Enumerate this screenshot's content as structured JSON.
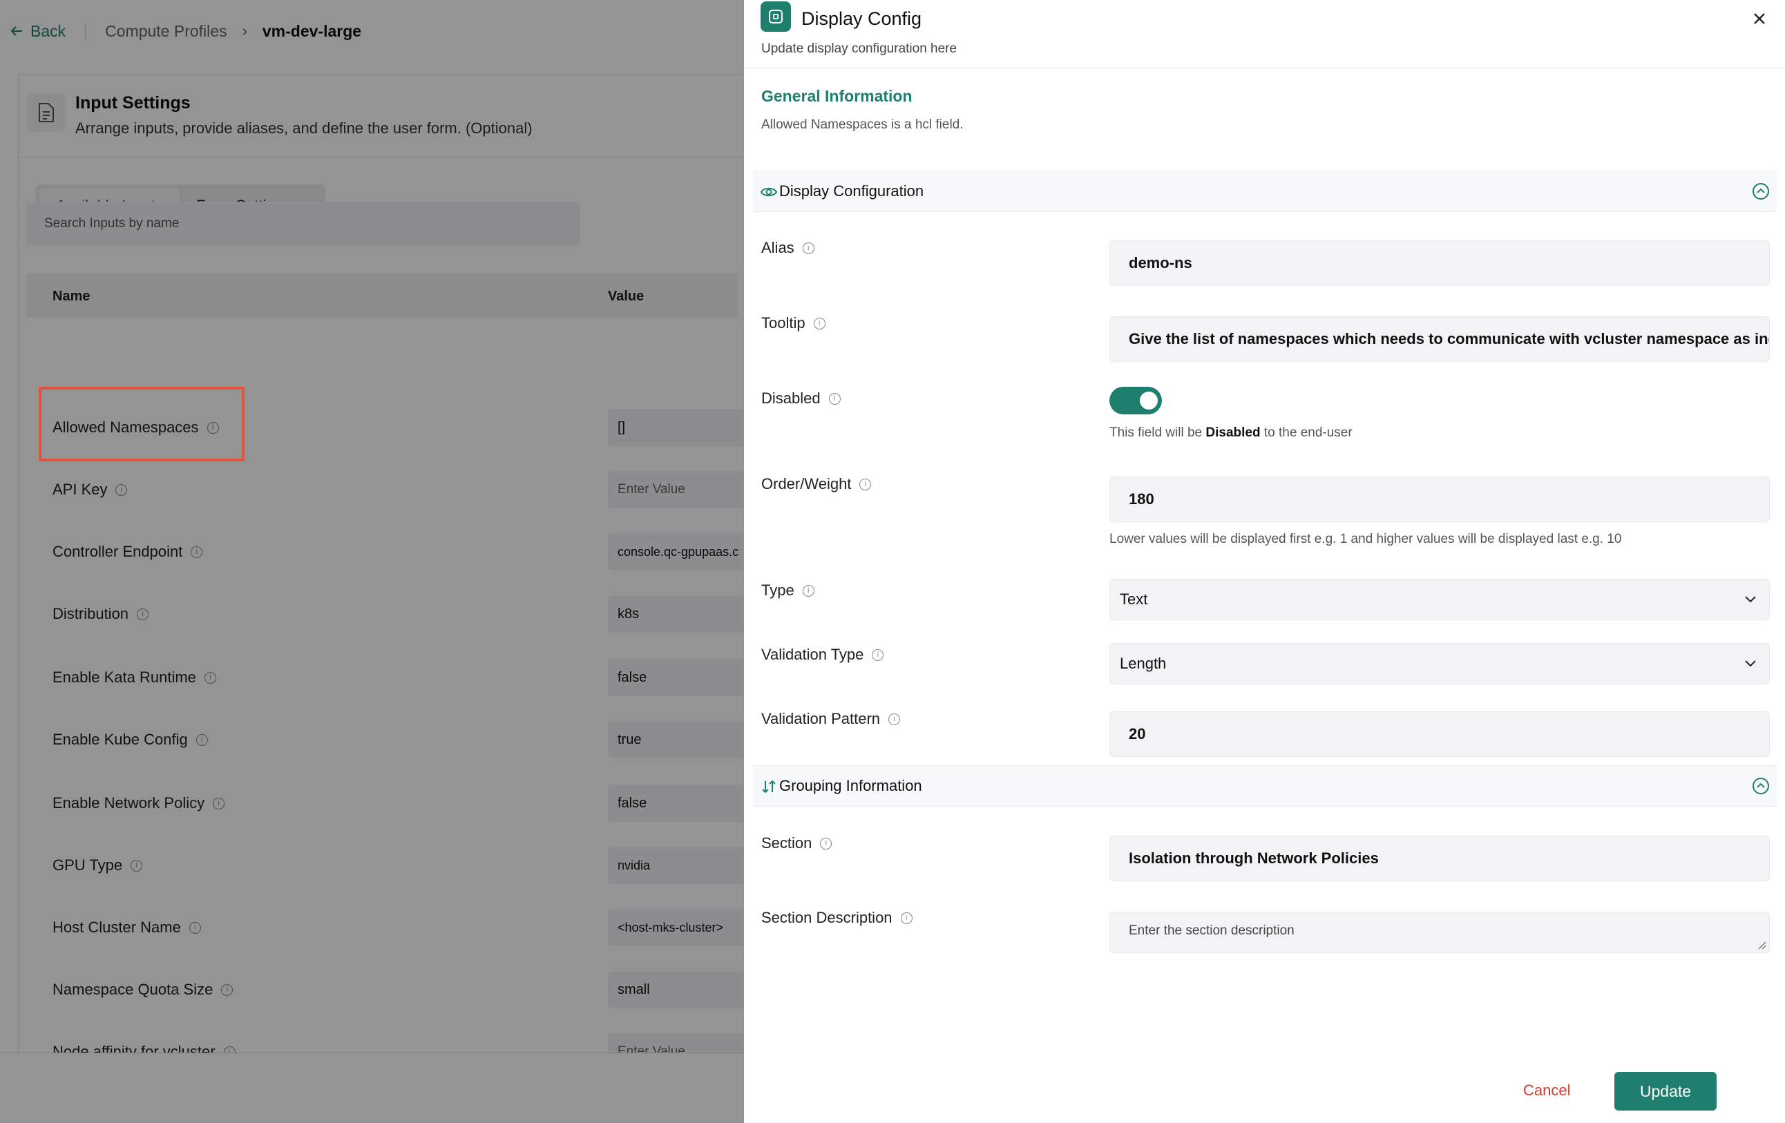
{
  "breadcrumb": {
    "back_label": "Back",
    "parent": "Compute Profiles",
    "current": "vm-dev-large"
  },
  "input_settings": {
    "title": "Input Settings",
    "subtitle": "Arrange inputs, provide aliases, and define the user form. (Optional)",
    "tabs": [
      {
        "label": "Available Inputs",
        "active": true
      },
      {
        "label": "Form Settings",
        "active": false
      }
    ],
    "search_placeholder": "Search Inputs by name",
    "columns": {
      "name": "Name",
      "value": "Value"
    },
    "rows": [
      {
        "name": "Allowed Namespaces",
        "value": "[]",
        "placeholder": false
      },
      {
        "name": "API Key",
        "value": "Enter Value",
        "placeholder": true
      },
      {
        "name": "Controller Endpoint",
        "value": "console.qc-gpupaas.c",
        "placeholder": false
      },
      {
        "name": "Distribution",
        "value": "k8s",
        "placeholder": false
      },
      {
        "name": "Enable Kata Runtime",
        "value": "false",
        "placeholder": false
      },
      {
        "name": "Enable Kube Config",
        "value": "true",
        "placeholder": false
      },
      {
        "name": "Enable Network Policy",
        "value": "false",
        "placeholder": false
      },
      {
        "name": "GPU Type",
        "value": "nvidia",
        "placeholder": false
      },
      {
        "name": "Host Cluster Name",
        "value": "<host-mks-cluster>",
        "placeholder": false
      },
      {
        "name": "Namespace Quota Size",
        "value": "small",
        "placeholder": false
      },
      {
        "name": "Node affinity for vcluster",
        "value": "Enter Value",
        "placeholder": true
      }
    ],
    "highlighted_row": "Allowed Namespaces"
  },
  "panel": {
    "title": "Display Config",
    "subtitle": "Update display configuration here",
    "general": {
      "title": "General Information",
      "field_name": "Allowed Namespaces",
      "field_note": " is a hcl field."
    },
    "display_section": {
      "title": "Display Configuration",
      "expanded": true
    },
    "fields": {
      "alias": {
        "label": "Alias",
        "value": "demo-ns"
      },
      "tooltip": {
        "label": "Tooltip",
        "value": "Give the list of namespaces which needs to communicate with vcluster namespace as ingr"
      },
      "disabled": {
        "label": "Disabled",
        "on": true,
        "help_prefix": "This field will be ",
        "help_bold": "Disabled",
        "help_suffix": " to the end-user"
      },
      "order": {
        "label": "Order/Weight",
        "value": "180",
        "help": "Lower values will be displayed first e.g. 1 and higher values will be displayed last e.g. 10"
      },
      "type": {
        "label": "Type",
        "value": "Text"
      },
      "validation_type": {
        "label": "Validation Type",
        "value": "Length"
      },
      "validation_pattern": {
        "label": "Validation Pattern",
        "value": "20"
      }
    },
    "grouping_section": {
      "title": "Grouping Information",
      "expanded": true
    },
    "grouping": {
      "section": {
        "label": "Section",
        "value": "Isolation through Network Policies"
      },
      "section_description": {
        "label": "Section Description",
        "placeholder": "Enter the section description"
      }
    },
    "actions": {
      "cancel": "Cancel",
      "update": "Update"
    }
  },
  "colors": {
    "accent": "#1f7f6e",
    "cancel": "#d33c2c",
    "highlight": "#e5533d"
  }
}
